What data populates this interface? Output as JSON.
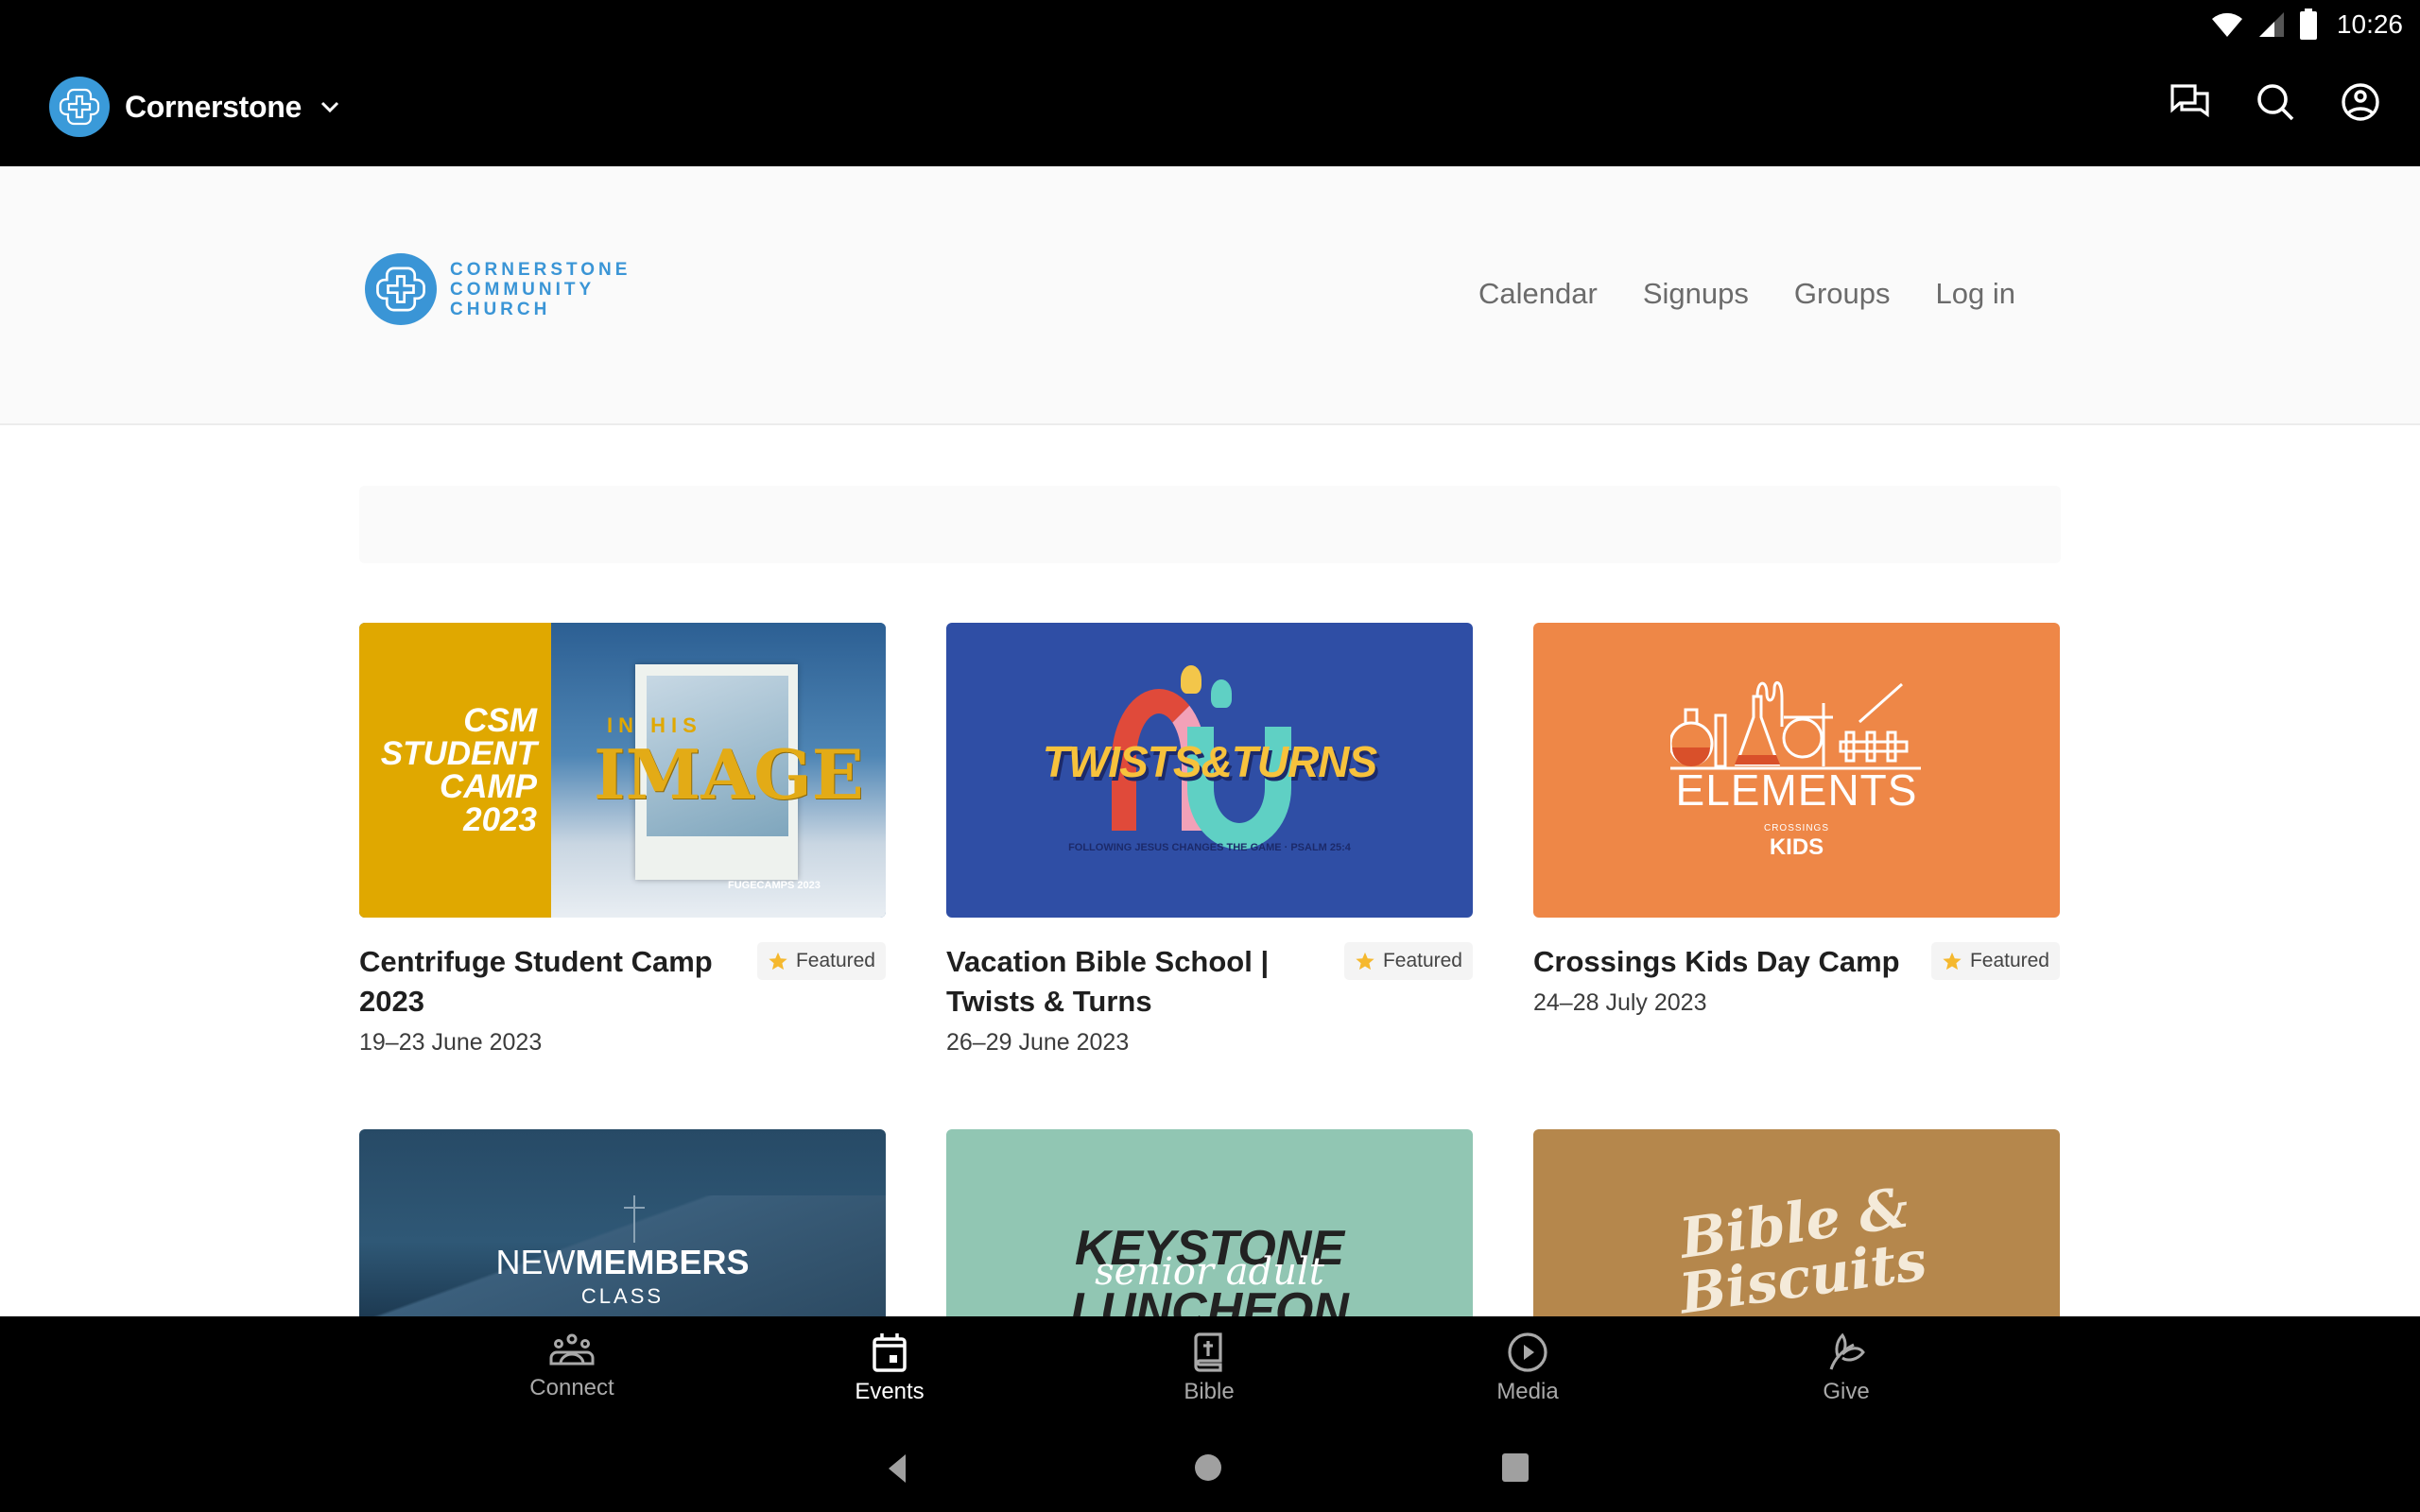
{
  "status_bar": {
    "time": "10:26",
    "icons": [
      "wifi-icon",
      "cell-signal-icon",
      "battery-icon"
    ]
  },
  "app_bar": {
    "title": "Cornerstone",
    "actions": [
      {
        "name": "messages",
        "icon": "chat-icon"
      },
      {
        "name": "search",
        "icon": "search-icon"
      },
      {
        "name": "account",
        "icon": "account-circle-icon"
      }
    ]
  },
  "site_header": {
    "logo_lines": [
      "CORNERSTONE",
      "COMMUNITY",
      "CHURCH"
    ],
    "nav": [
      "Calendar",
      "Signups",
      "Groups",
      "Log in"
    ]
  },
  "events": [
    {
      "title": "Centrifuge Student Camp 2023",
      "date": "19–23 June 2023",
      "badge": "Featured",
      "image": {
        "left_text": [
          "CSM",
          "STUDENT",
          "CAMP",
          "2023"
        ],
        "overlay_small": "IN HIS",
        "overlay_big": "IMAGE",
        "footer": "FUGECAMPS 2023",
        "left_color": "#e0a800",
        "sky_color": "#2f6496"
      }
    },
    {
      "title": "Vacation Bible School | Twists & Turns",
      "date": "26–29 June 2023",
      "badge": "Featured",
      "image": {
        "headline": "TWISTS&TURNS",
        "subline": "FOLLOWING JESUS CHANGES THE GAME · PSALM 25:4",
        "bg_color": "#2f4ea5"
      }
    },
    {
      "title": "Crossings Kids Day Camp",
      "date": "24–28 July 2023",
      "badge": "Featured",
      "image": {
        "headline": "ELEMENTS",
        "sub_small": "CROSSINGS",
        "sub_big": "KIDS",
        "bg_color": "#ee8747"
      }
    }
  ],
  "events_row2": [
    {
      "image_text_light": "NEW",
      "image_text_bold": "MEMBERS",
      "image_sub": "CLASS"
    },
    {
      "image_text_bold": "KEYSTONE",
      "image_script": "senior adult",
      "image_text_cut": "LUNCHEON"
    },
    {
      "image_script": "Bible & Biscuits"
    }
  ],
  "bottom_nav": {
    "items": [
      {
        "label": "Connect",
        "icon": "people-icon",
        "active": false
      },
      {
        "label": "Events",
        "icon": "calendar-icon",
        "active": true
      },
      {
        "label": "Bible",
        "icon": "bible-icon",
        "active": false
      },
      {
        "label": "Media",
        "icon": "play-circle-icon",
        "active": false
      },
      {
        "label": "Give",
        "icon": "leaf-icon",
        "active": false
      }
    ]
  },
  "colors": {
    "brand_blue": "#3a95d6",
    "badge_star": "#f5b82e"
  }
}
